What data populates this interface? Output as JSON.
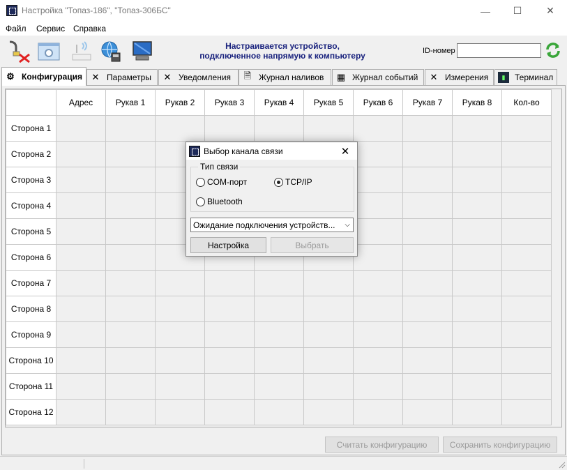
{
  "window": {
    "title": "Настройка \"Топаз-186\", \"Топаз-306БС\""
  },
  "menu": [
    "Файл",
    "Сервис",
    "Справка"
  ],
  "toolbar": {
    "banner_line1": "Настраивается устройство,",
    "banner_line2": "подключенное напрямую к компьютеру",
    "id_label": "ID-номер",
    "id_value": ""
  },
  "tabs": [
    "Конфигурация",
    "Параметры",
    "Уведомления",
    "Журнал наливов",
    "Журнал событий",
    "Измерения",
    "Терминал"
  ],
  "grid": {
    "columns": [
      "Адрес",
      "Рукав 1",
      "Рукав 2",
      "Рукав 3",
      "Рукав 4",
      "Рукав 5",
      "Рукав 6",
      "Рукав 7",
      "Рукав 8",
      "Кол-во"
    ],
    "rows": [
      "Сторона 1",
      "Сторона 2",
      "Сторона 3",
      "Сторона 4",
      "Сторона 5",
      "Сторона 6",
      "Сторона 7",
      "Сторона 8",
      "Сторона 9",
      "Сторона 10",
      "Сторона 11",
      "Сторона 12"
    ]
  },
  "buttons": {
    "read_config": "Считать конфигурацию",
    "save_config": "Сохранить конфигурацию"
  },
  "dialog": {
    "title": "Выбор канала связи",
    "group_label": "Тип связи",
    "radio_com": "COM-порт",
    "radio_tcp": "TCP/IP",
    "radio_bt": "Bluetooth",
    "selected": "TCP/IP",
    "select_value": "Ожидание подключения устройств...",
    "setup_button": "Настройка",
    "choose_button": "Выбрать"
  }
}
